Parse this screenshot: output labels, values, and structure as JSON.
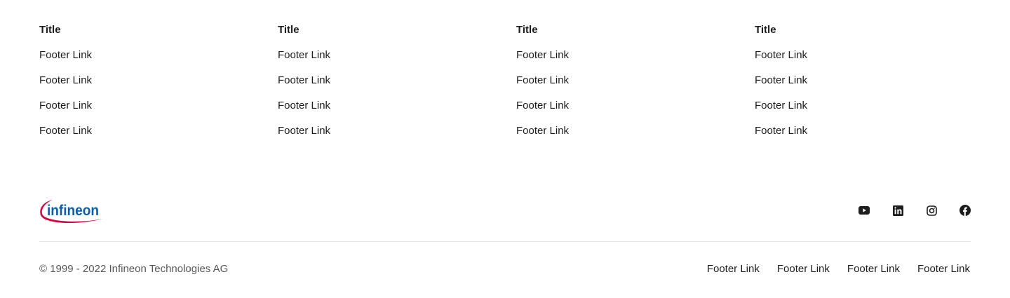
{
  "columns": [
    {
      "title": "Title",
      "links": [
        "Footer Link",
        "Footer Link",
        "Footer Link",
        "Footer Link"
      ]
    },
    {
      "title": "Title",
      "links": [
        "Footer Link",
        "Footer Link",
        "Footer Link",
        "Footer Link"
      ]
    },
    {
      "title": "Title",
      "links": [
        "Footer Link",
        "Footer Link",
        "Footer Link",
        "Footer Link"
      ]
    },
    {
      "title": "Title",
      "links": [
        "Footer Link",
        "Footer Link",
        "Footer Link",
        "Footer Link"
      ]
    }
  ],
  "logo": {
    "text": "infineon",
    "text_color": "#0a5fa8",
    "swoosh_color": "#d4003c"
  },
  "social": [
    "youtube-icon",
    "linkedin-icon",
    "instagram-icon",
    "facebook-icon"
  ],
  "copyright": "© 1999 - 2022 Infineon Technologies AG",
  "bottom_links": [
    "Footer Link",
    "Footer Link",
    "Footer Link",
    "Footer Link"
  ]
}
